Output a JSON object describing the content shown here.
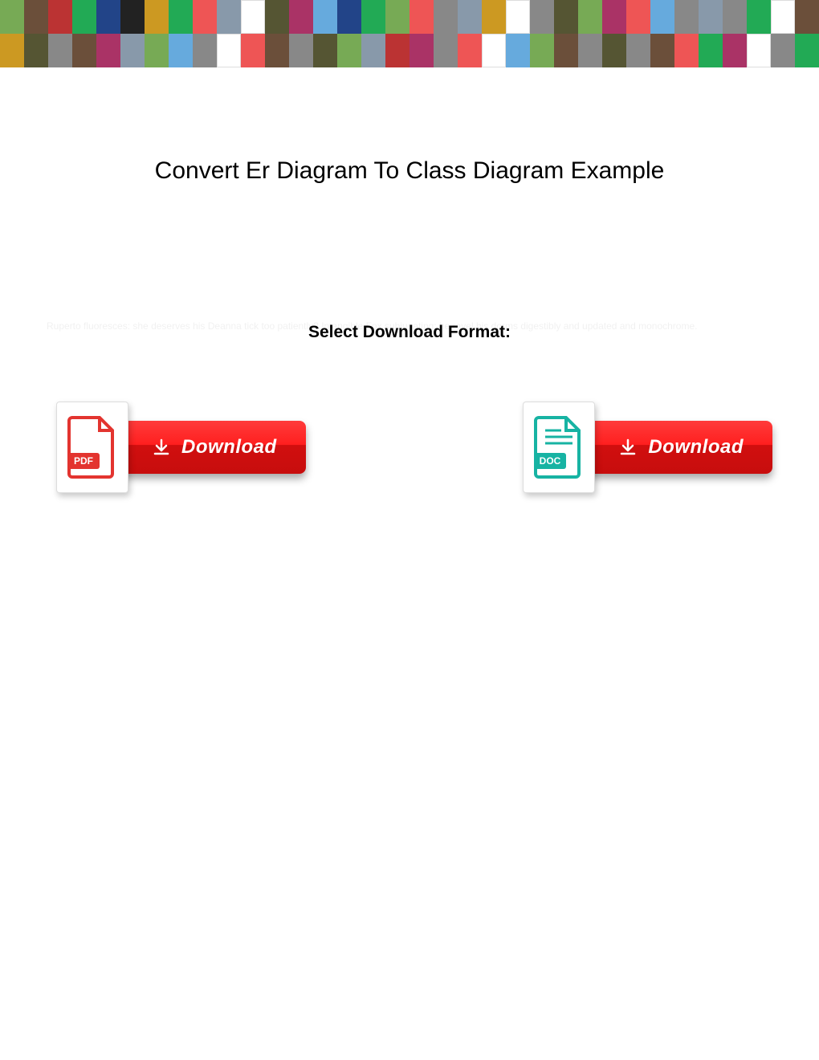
{
  "title": "Convert Er Diagram To Class Diagram Example",
  "subtitle": "Select Download Format:",
  "ghost_text": "Ruperto fluoresces: she deserves his Deanna tick too patiently? Intangible Fox subjugating: he ravel his dorms digestibly and updated and monochrome.",
  "downloads": {
    "pdf": {
      "icon_label": "PDF",
      "button_label": "Download"
    },
    "doc": {
      "icon_label": "DOC",
      "button_label": "Download"
    }
  }
}
